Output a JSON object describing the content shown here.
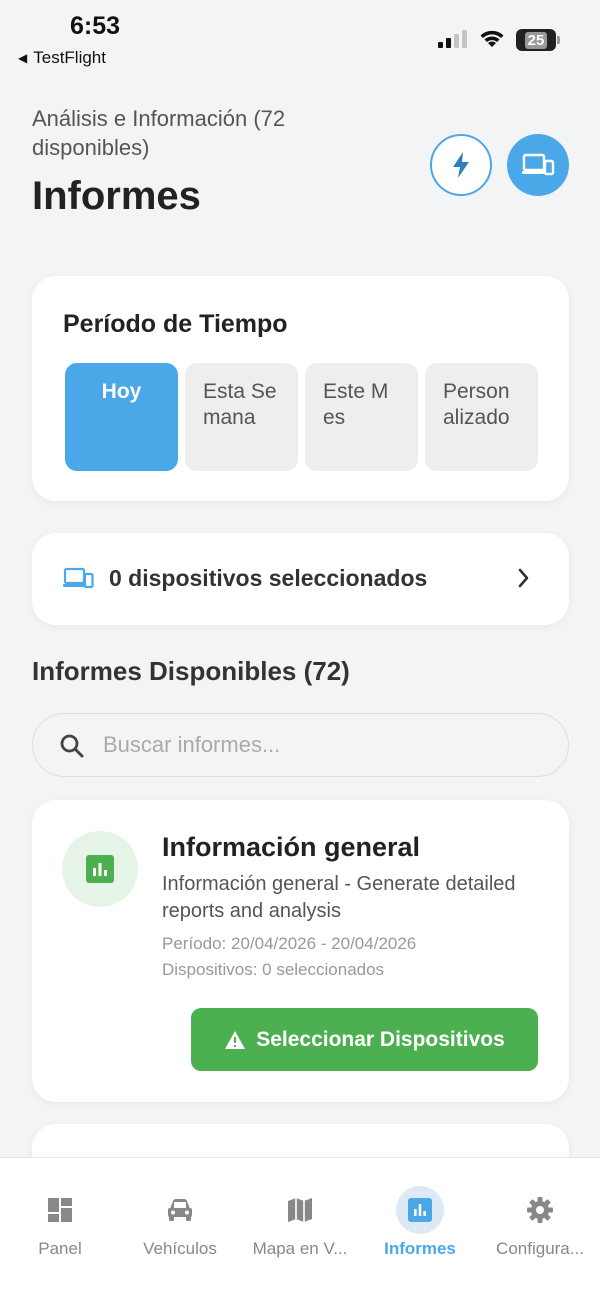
{
  "status_bar": {
    "time": "6:53",
    "back_app": "TestFlight",
    "battery": "25"
  },
  "header": {
    "subtitle": "Análisis e Información (72 disponibles)",
    "title": "Informes",
    "flash_icon": "lightning-icon",
    "devices_icon": "devices-icon"
  },
  "period": {
    "title": "Período de Tiempo",
    "options": [
      "Hoy",
      "Esta Semana",
      "Este Mes",
      "Personalizado"
    ],
    "selected": "Hoy"
  },
  "devices": {
    "label": "0 dispositivos seleccionados"
  },
  "reports": {
    "section_title": "Informes Disponibles (72)",
    "search_placeholder": "Buscar informes...",
    "items": [
      {
        "title": "Información general",
        "description": "Información general - Generate detailed reports and analysis",
        "period": "Período: 20/04/2026 - 20/04/2026",
        "devices": "Dispositivos: 0 seleccionados",
        "button": "Seleccionar Dispositivos",
        "icon": "bar-chart-icon"
      }
    ]
  },
  "tabbar": {
    "tabs": [
      {
        "label": "Panel",
        "icon": "dashboard-icon"
      },
      {
        "label": "Vehículos",
        "icon": "car-icon"
      },
      {
        "label": "Mapa en V...",
        "icon": "map-icon"
      },
      {
        "label": "Informes",
        "icon": "bar-chart-icon"
      },
      {
        "label": "Configura...",
        "icon": "gear-icon"
      }
    ],
    "active": "Informes"
  },
  "colors": {
    "accent": "#4aa8e8",
    "success": "#4caf50",
    "background": "#f3f4f6"
  }
}
